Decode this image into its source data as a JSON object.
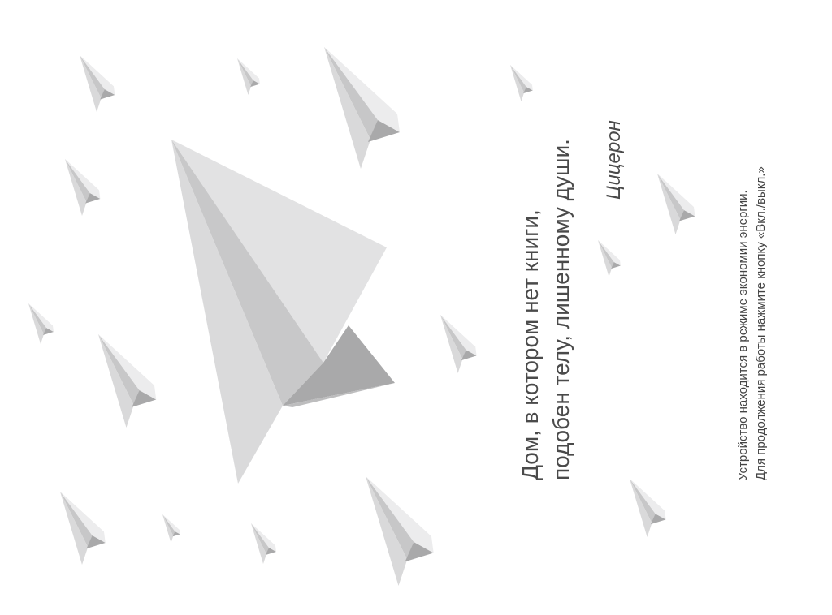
{
  "screensaver": {
    "quote": {
      "line1": "Дом, в котором нет книги,",
      "line2": "подобен телу, лишенному души."
    },
    "author": "Цицерон",
    "notice": {
      "line1": "Устройство находится в режиме экономии энергии.",
      "line2": "Для продолжения работы нажмите кнопку «Вкл./выкл.»"
    },
    "background": {
      "motif": "paper-plane-icon",
      "colors": {
        "background": "#ffffff",
        "plane_light": "#e3e3e4",
        "plane_mid": "#c7c7c8",
        "plane_dark": "#a9a9aa",
        "text": "#4a4a4a"
      }
    }
  }
}
